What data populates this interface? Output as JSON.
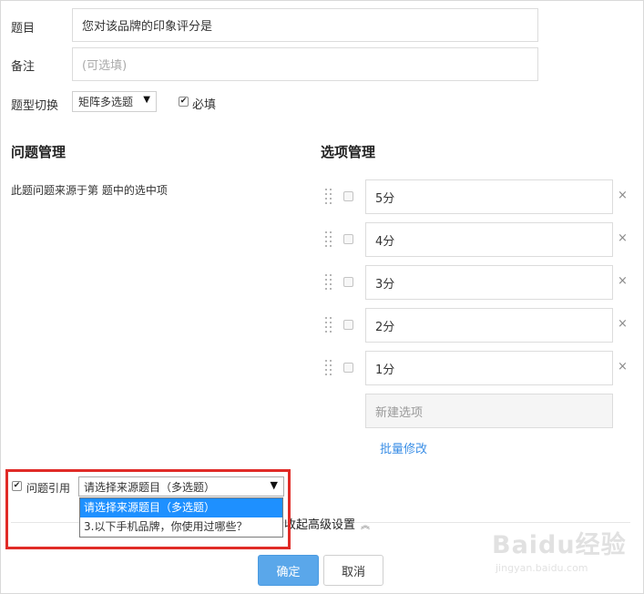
{
  "form": {
    "title_label": "题目",
    "title_value": "您对该品牌的印象评分是",
    "note_label": "备注",
    "note_placeholder": "(可选填)",
    "type_label": "题型切换",
    "type_value": "矩阵多选题",
    "required_label": "必填",
    "required_checked": true
  },
  "questions": {
    "heading": "问题管理",
    "source_text": "此题问题来源于第  题中的选中项"
  },
  "options": {
    "heading": "选项管理",
    "items": [
      {
        "label": "5分"
      },
      {
        "label": "4分"
      },
      {
        "label": "3分"
      },
      {
        "label": "2分"
      },
      {
        "label": "1分"
      }
    ],
    "new_placeholder": "新建选项",
    "bulk_edit": "批量修改"
  },
  "reference": {
    "checkbox_label": "问题引用",
    "checked": true,
    "selected_value": "请选择来源题目（多选题）",
    "dropdown_options": [
      "请选择来源题目（多选题）",
      "3.以下手机品牌，你使用过哪些？"
    ]
  },
  "advanced": {
    "label": "收起高级设置"
  },
  "buttons": {
    "confirm": "确定",
    "cancel": "取消"
  },
  "watermark": {
    "main": "Baidu经验",
    "sub": "jingyan.baidu.com"
  },
  "colors": {
    "link": "#3a8ee6",
    "primary_button": "#5aa7ea",
    "dropdown_selected": "#1e90ff",
    "highlight_border": "#e02b27"
  }
}
